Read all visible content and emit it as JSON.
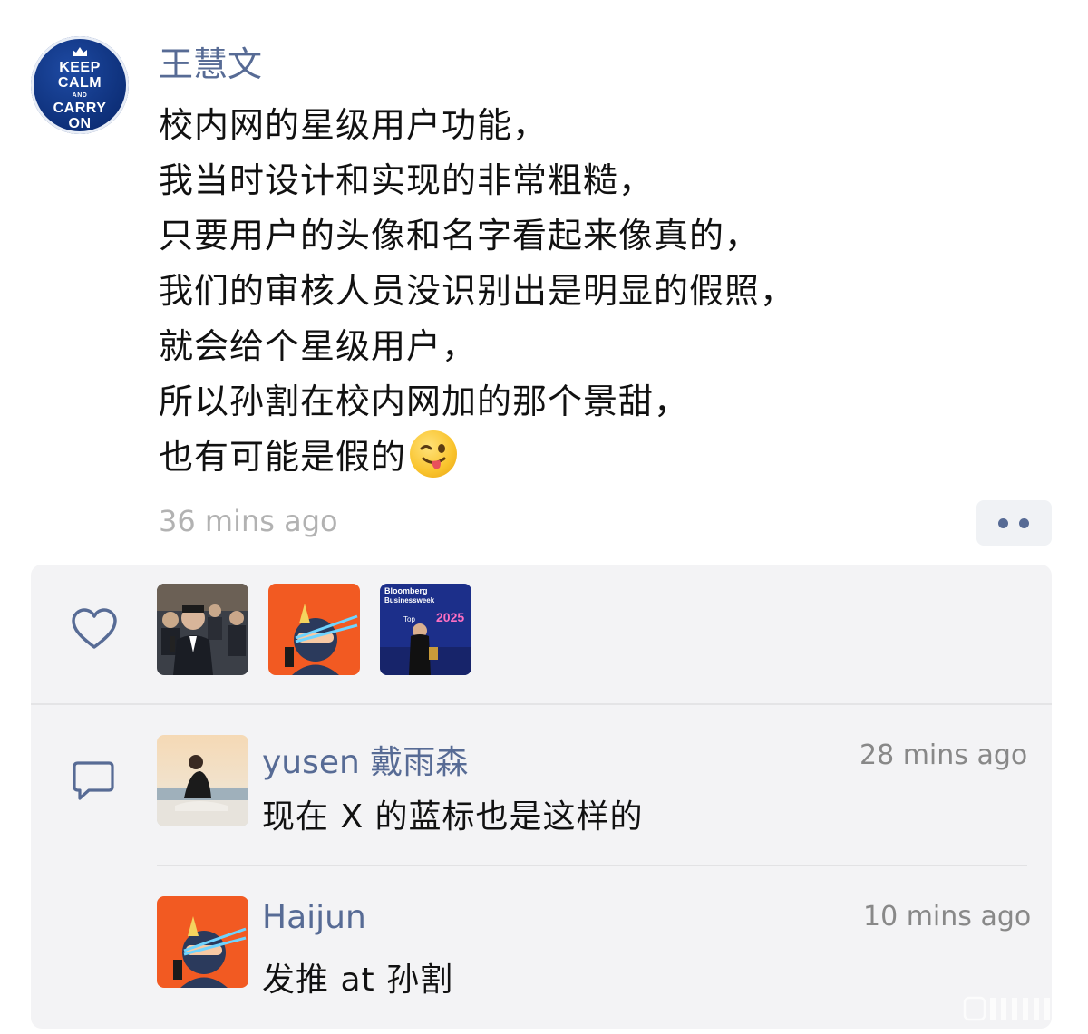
{
  "post": {
    "avatar_text": [
      "KEEP",
      "CALM",
      "AND",
      "CARRY",
      "ON"
    ],
    "author": "王慧文",
    "lines": [
      "校内网的星级用户功能，",
      "我当时设计和实现的非常粗糙，",
      "只要用户的头像和名字看起来像真的，",
      "我们的审核人员没识别出是明显的假照，",
      "就会给个星级用户，",
      "所以孙割在校内网加的那个景甜，",
      "也有可能是假的"
    ],
    "emoji": "winking-face-with-tongue",
    "time": "36 mins ago"
  },
  "likes": {
    "icon": "heart-icon",
    "users": [
      "photo-man-microphone",
      "cartoon-ninja-orange",
      "bloomberg-event-photo"
    ],
    "bloomberg_text": [
      "Bloomberg",
      "Businessweek",
      "Top",
      "2025"
    ]
  },
  "comments": [
    {
      "name": "yusen  戴雨森",
      "time": "28 mins ago",
      "text": "现在 X 的蓝标也是这样的",
      "avatar": "photo-man-sitting-beach"
    },
    {
      "name": "Haijun",
      "time": "10 mins ago",
      "text": "发推 at 孙割",
      "avatar": "cartoon-ninja-orange"
    }
  ],
  "colors": {
    "link": "#576b95",
    "panel": "#f3f3f5",
    "time": "#b2b2b2"
  }
}
